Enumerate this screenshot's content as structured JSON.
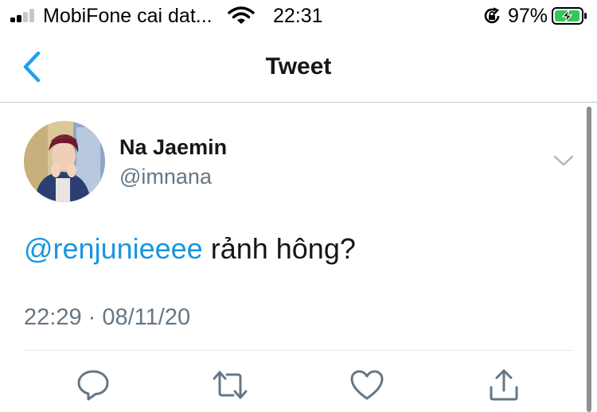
{
  "status_bar": {
    "carrier": "MobiFone cai dat...",
    "time": "22:31",
    "battery_percent": "97%",
    "battery_level": 0.97,
    "signal_bars_active": 2,
    "signal_bars_total": 4,
    "icons": [
      "signal-icon",
      "wifi-icon",
      "orientation-lock-icon",
      "battery-charging-icon"
    ]
  },
  "nav": {
    "title": "Tweet",
    "back_icon": "chevron-left-icon"
  },
  "tweet": {
    "author": {
      "name": "Na Jaemin",
      "handle": "@imnana"
    },
    "mention": "@renjunieeee",
    "text": " rảnh hông?",
    "timestamp": "22:29 · 08/11/20",
    "menu_icon": "chevron-down-icon"
  },
  "actions": [
    {
      "name": "reply",
      "icon": "reply-icon"
    },
    {
      "name": "retweet",
      "icon": "retweet-icon"
    },
    {
      "name": "like",
      "icon": "heart-icon"
    },
    {
      "name": "share",
      "icon": "share-icon"
    }
  ],
  "colors": {
    "accent": "#1da1f2",
    "mention": "#1b95e0",
    "secondary_text": "#657786",
    "divider": "#e1e8ed",
    "battery_green": "#34c759"
  }
}
